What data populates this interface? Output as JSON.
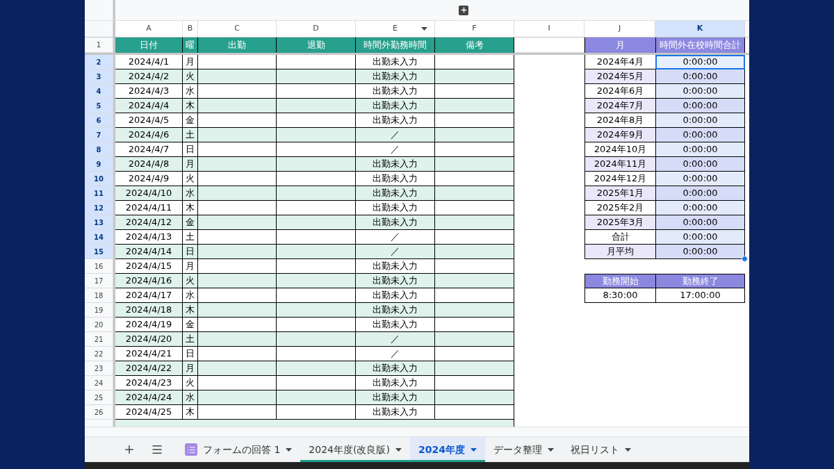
{
  "column_headers": [
    {
      "label": "A",
      "selected": false
    },
    {
      "label": "B",
      "selected": false
    },
    {
      "label": "C",
      "selected": false
    },
    {
      "label": "D",
      "selected": false
    },
    {
      "label": "E",
      "selected": false,
      "filter": true
    },
    {
      "label": "F",
      "selected": false
    },
    {
      "label": "I",
      "selected": false
    },
    {
      "label": "J",
      "selected": false
    },
    {
      "label": "K",
      "selected": true
    }
  ],
  "header_row": {
    "number": "1",
    "cells": [
      "日付",
      "曜",
      "出勤",
      "退勤",
      "時間外勤務時間",
      "備考"
    ]
  },
  "rows": [
    {
      "number": "2",
      "selected": true,
      "date": "2024/4/1",
      "weekday": "月",
      "overtime": "出勤未入力"
    },
    {
      "number": "3",
      "selected": true,
      "date": "2024/4/2",
      "weekday": "火",
      "overtime": "出勤未入力"
    },
    {
      "number": "4",
      "selected": true,
      "date": "2024/4/3",
      "weekday": "水",
      "overtime": "出勤未入力"
    },
    {
      "number": "5",
      "selected": true,
      "date": "2024/4/4",
      "weekday": "木",
      "overtime": "出勤未入力"
    },
    {
      "number": "6",
      "selected": true,
      "date": "2024/4/5",
      "weekday": "金",
      "overtime": "出勤未入力"
    },
    {
      "number": "7",
      "selected": true,
      "date": "2024/4/6",
      "weekday": "土",
      "overtime": "／"
    },
    {
      "number": "8",
      "selected": true,
      "date": "2024/4/7",
      "weekday": "日",
      "overtime": "／"
    },
    {
      "number": "9",
      "selected": true,
      "date": "2024/4/8",
      "weekday": "月",
      "overtime": "出勤未入力"
    },
    {
      "number": "10",
      "selected": true,
      "date": "2024/4/9",
      "weekday": "火",
      "overtime": "出勤未入力"
    },
    {
      "number": "11",
      "selected": true,
      "date": "2024/4/10",
      "weekday": "水",
      "overtime": "出勤未入力"
    },
    {
      "number": "12",
      "selected": true,
      "date": "2024/4/11",
      "weekday": "木",
      "overtime": "出勤未入力"
    },
    {
      "number": "13",
      "selected": true,
      "date": "2024/4/12",
      "weekday": "金",
      "overtime": "出勤未入力"
    },
    {
      "number": "14",
      "selected": true,
      "date": "2024/4/13",
      "weekday": "土",
      "overtime": "／"
    },
    {
      "number": "15",
      "selected": true,
      "date": "2024/4/14",
      "weekday": "日",
      "overtime": "／"
    },
    {
      "number": "16",
      "selected": false,
      "date": "2024/4/15",
      "weekday": "月",
      "overtime": "出勤未入力"
    },
    {
      "number": "17",
      "selected": false,
      "date": "2024/4/16",
      "weekday": "火",
      "overtime": "出勤未入力"
    },
    {
      "number": "18",
      "selected": false,
      "date": "2024/4/17",
      "weekday": "水",
      "overtime": "出勤未入力"
    },
    {
      "number": "19",
      "selected": false,
      "date": "2024/4/18",
      "weekday": "木",
      "overtime": "出勤未入力"
    },
    {
      "number": "20",
      "selected": false,
      "date": "2024/4/19",
      "weekday": "金",
      "overtime": "出勤未入力"
    },
    {
      "number": "21",
      "selected": false,
      "date": "2024/4/20",
      "weekday": "土",
      "overtime": "／"
    },
    {
      "number": "22",
      "selected": false,
      "date": "2024/4/21",
      "weekday": "日",
      "overtime": "／"
    },
    {
      "number": "23",
      "selected": false,
      "date": "2024/4/22",
      "weekday": "月",
      "overtime": "出勤未入力"
    },
    {
      "number": "24",
      "selected": false,
      "date": "2024/4/23",
      "weekday": "火",
      "overtime": "出勤未入力"
    },
    {
      "number": "25",
      "selected": false,
      "date": "2024/4/24",
      "weekday": "水",
      "overtime": "出勤未入力"
    },
    {
      "number": "26",
      "selected": false,
      "date": "2024/4/25",
      "weekday": "木",
      "overtime": "出勤未入力"
    }
  ],
  "summary": {
    "headers": [
      "月",
      "時間外在校時間合計"
    ],
    "rows": [
      {
        "month": "2024年4月",
        "total": "0:00:00"
      },
      {
        "month": "2024年5月",
        "total": "0:00:00"
      },
      {
        "month": "2024年6月",
        "total": "0:00:00"
      },
      {
        "month": "2024年7月",
        "total": "0:00:00"
      },
      {
        "month": "2024年8月",
        "total": "0:00:00"
      },
      {
        "month": "2024年9月",
        "total": "0:00:00"
      },
      {
        "month": "2024年10月",
        "total": "0:00:00"
      },
      {
        "month": "2024年11月",
        "total": "0:00:00"
      },
      {
        "month": "2024年12月",
        "total": "0:00:00"
      },
      {
        "month": "2025年1月",
        "total": "0:00:00"
      },
      {
        "month": "2025年2月",
        "total": "0:00:00"
      },
      {
        "month": "2025年3月",
        "total": "0:00:00"
      },
      {
        "month": "合計",
        "total": "0:00:00"
      },
      {
        "month": "月平均",
        "total": "0:00:00"
      }
    ]
  },
  "work_hours": {
    "headers": [
      "勤務開始",
      "勤務終了"
    ],
    "values": [
      "8:30:00",
      "17:00:00"
    ]
  },
  "sheet_tabs": [
    {
      "label": "フォームの回答 1",
      "selected": false,
      "kind": "form"
    },
    {
      "label": "2024年度(改良版)",
      "selected": false,
      "kind": "sheet",
      "color": "#1e9e88"
    },
    {
      "label": "2024年度",
      "selected": true,
      "kind": "sheet",
      "color": "#1e9e88"
    },
    {
      "label": "データ整理",
      "selected": false,
      "kind": "sheet"
    },
    {
      "label": "祝日リスト",
      "selected": false,
      "kind": "sheet"
    }
  ]
}
